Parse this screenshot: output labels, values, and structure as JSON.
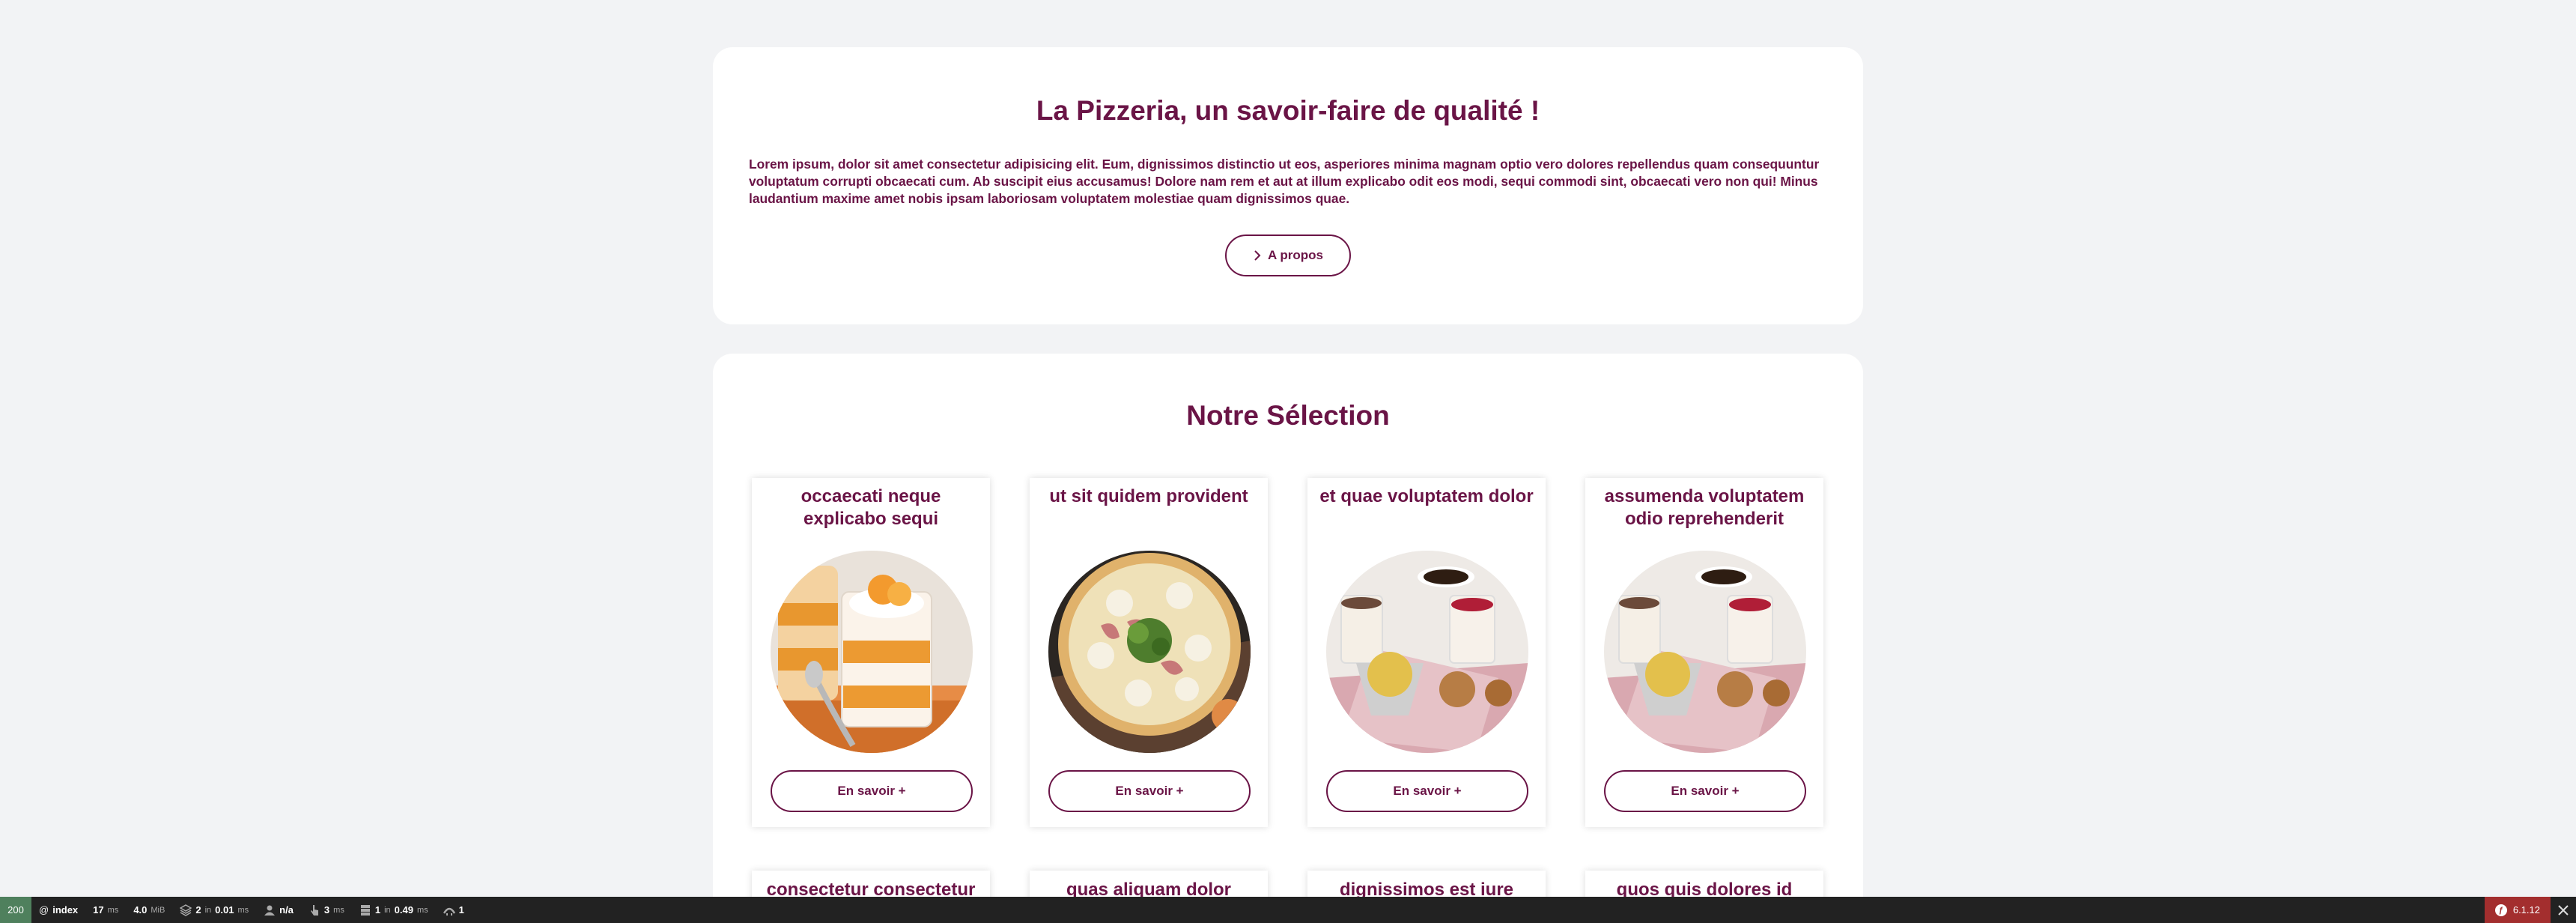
{
  "about": {
    "title": "La Pizzeria, un savoir-faire de qualité !",
    "text": "Lorem ipsum, dolor sit amet consectetur adipisicing elit. Eum, dignissimos distinctio ut eos, asperiores minima magnam optio vero dolores repellendus quam consequuntur voluptatum corrupti obcaecati cum. Ab suscipit eius accusamus! Dolore nam rem et aut at illum explicabo odit eos modi, sequi commodi sint, obcaecati vero non qui! Minus laudantium maxime amet nobis ipsam laboriosam voluptatem molestiae quam dignissimos quae.",
    "button_label": "A propos"
  },
  "selection": {
    "title": "Notre Sélection",
    "cards": [
      {
        "title": "occaecati neque explicabo sequi",
        "button_label": "En savoir +",
        "image": "dessert-verrine"
      },
      {
        "title": "ut sit quidem provident",
        "button_label": "En savoir +",
        "image": "pizza"
      },
      {
        "title": "et quae voluptatem dolor",
        "button_label": "En savoir +",
        "image": "cafe-gourmand"
      },
      {
        "title": "assumenda voluptatem odio reprehenderit",
        "button_label": "En savoir +",
        "image": "cafe-gourmand"
      }
    ],
    "next_row": [
      {
        "title": "consectetur consectetur"
      },
      {
        "title": "quas aliquam dolor"
      },
      {
        "title": "dignissimos est iure"
      },
      {
        "title": "quos quis dolores id"
      }
    ]
  },
  "toolbar": {
    "status_code": "200",
    "route": "index",
    "time_value": "17",
    "time_unit": "ms",
    "memory_value": "4.0",
    "memory_unit": "MiB",
    "cache_value": "2",
    "cache_in": "in",
    "cache_time": "0.01",
    "cache_unit": "ms",
    "user": "n/a",
    "events_value": "3",
    "events_unit": "ms",
    "db_value": "1",
    "db_in": "in",
    "db_time": "0.49",
    "db_unit": "ms",
    "twig_value": "1",
    "version": "6.1.12",
    "colors": {
      "status_ok": "#4f805d",
      "version_bg": "#a32e2e",
      "bar_bg": "#222222"
    }
  },
  "colors": {
    "brand": "#6a1446",
    "page_bg": "#f2f3f5"
  }
}
